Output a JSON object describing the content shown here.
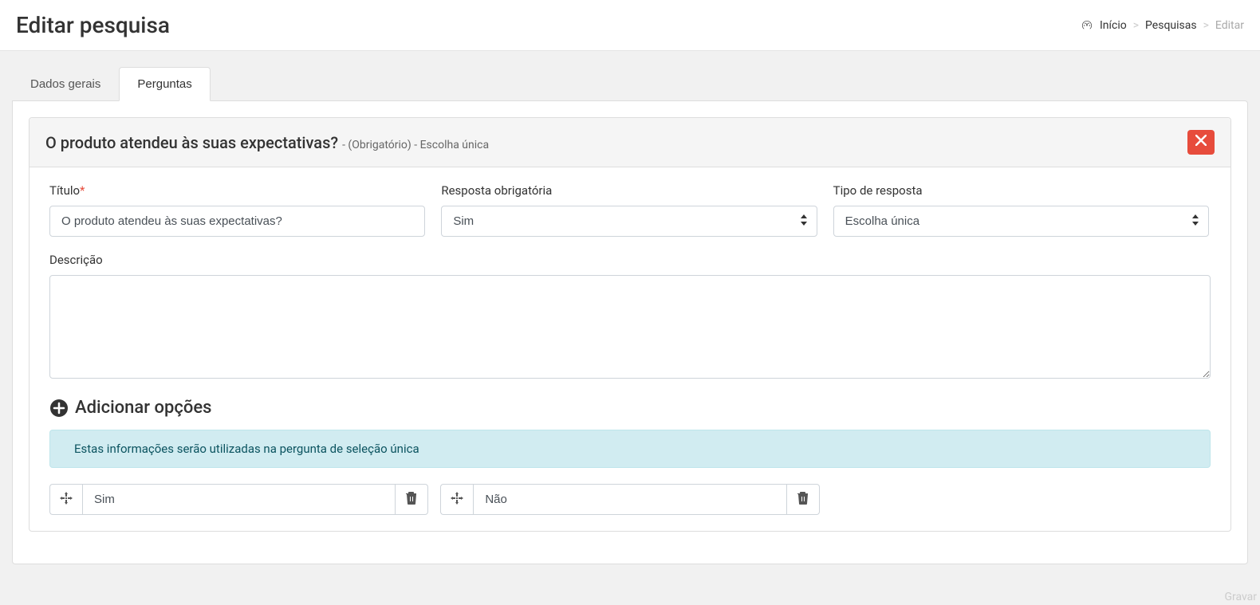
{
  "header": {
    "title": "Editar pesquisa",
    "breadcrumb": {
      "home": "Início",
      "surveys": "Pesquisas",
      "edit": "Editar"
    }
  },
  "tabs": {
    "general": "Dados gerais",
    "questions": "Perguntas"
  },
  "question": {
    "title": "O produto atendeu às suas expectativas?",
    "meta": " - (Obrigatório) - Escolha única",
    "labels": {
      "title": "Título",
      "required": "Resposta obrigatória",
      "type": "Tipo de resposta",
      "description": "Descrição"
    },
    "values": {
      "title": "O produto atendeu às suas expectativas?",
      "required": "Sim",
      "type": "Escolha única",
      "description": ""
    }
  },
  "options": {
    "heading": "Adicionar opções",
    "info": "Estas informações serão utilizadas na pergunta de seleção única",
    "items": [
      "Sim",
      "Não"
    ]
  },
  "footer": {
    "hint": "Gravar"
  }
}
